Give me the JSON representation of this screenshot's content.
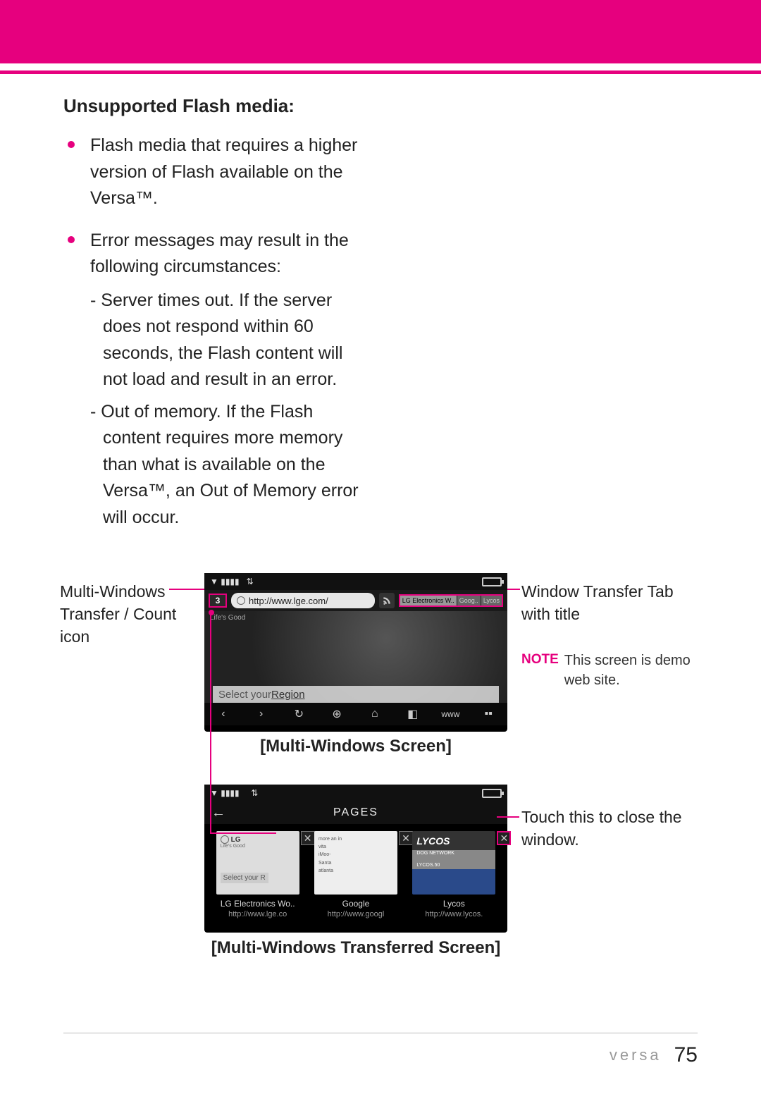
{
  "header": {
    "section_title": "Unsupported Flash media:"
  },
  "bullets": [
    {
      "text": "Flash media that requires a higher version of Flash available on the Versa™."
    },
    {
      "text": "Error messages may result in the following circumstances:",
      "sub": [
        "- Server times out. If the server does not respond within 60 seconds, the Flash content will not load and result in an error.",
        "- Out of memory. If the Flash content requires more memory than what is available on the Versa™, an Out of Memory error will occur."
      ]
    }
  ],
  "figures": {
    "callout_multi_windows": "Multi-Windows Transfer / Count icon",
    "callout_window_tab": "Window Transfer Tab with title",
    "note_label": "NOTE",
    "note_text": "This screen is demo web site.",
    "callout_close": "Touch this to close the window.",
    "caption1": "[Multi-Windows Screen]",
    "caption2": "[Multi-Windows Transferred Screen]",
    "screen1": {
      "multi_count": "3",
      "address": "http://www.lge.com/",
      "tab1": "LG Electronics W..",
      "tab2": "Goog..",
      "tab3": "Lycos",
      "lifes_good": "Life's Good",
      "region_prefix": "Select your ",
      "region_bold": "Region",
      "www": "www"
    },
    "screen2": {
      "pages_title": "PAGES",
      "thumbs": [
        {
          "logo": "LG",
          "sub": "Life's Good",
          "below": "Select your R",
          "title": "LG Electronics Wo..",
          "url": "http://www.lge.co"
        },
        {
          "title": "Google",
          "url": "http://www.googl"
        },
        {
          "logo": "LYCOS",
          "sub1": "DOG NETWORK",
          "sub2": "LYCOS.50",
          "title": "Lycos",
          "url": "http://www.lycos."
        }
      ]
    }
  },
  "footer": {
    "brand": "versa",
    "page": "75"
  }
}
